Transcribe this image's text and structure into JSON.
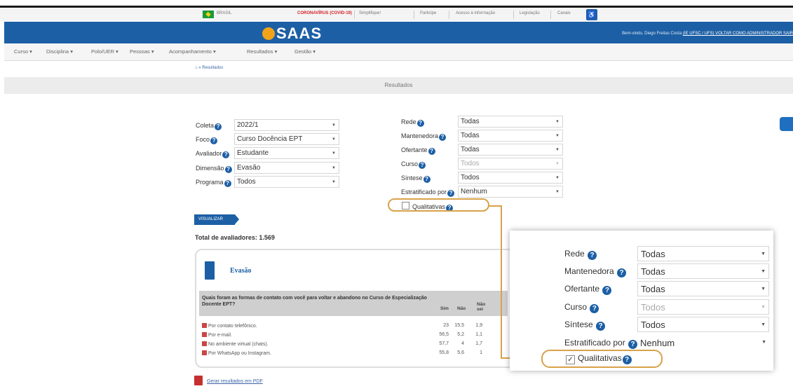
{
  "govbar": {
    "brasil": "BRASIL",
    "items": [
      "CORONAVÍRUS (COVID-19)",
      "Simplifique!",
      "Participe",
      "Acesso à informação",
      "Legislação",
      "Canais"
    ]
  },
  "header": {
    "logo": "SAAS",
    "welcome": "Bem-vindo, Diego Freitas Costa",
    "welcome_links": "(IE UFSC / UFS)   VOLTAR COMO ADMINISTRADOR   SAIR"
  },
  "nav": [
    "Curso",
    "Disciplina",
    "Polo/UER",
    "Pessoas",
    "Acompanhamento",
    "Resultados",
    "Gestão"
  ],
  "breadcrumb": "⌂ » Resultados",
  "page_title": "Resultados",
  "form_left": [
    {
      "label": "Coleta",
      "value": "2022/1"
    },
    {
      "label": "Foco",
      "value": "Curso Docência EPT"
    },
    {
      "label": "Avaliador",
      "value": "Estudante"
    },
    {
      "label": "Dimensão",
      "value": "Evasão"
    },
    {
      "label": "Programa",
      "value": "Todos"
    }
  ],
  "form_right": [
    {
      "label": "Rede",
      "value": "Todas"
    },
    {
      "label": "Mantenedora",
      "value": "Todas"
    },
    {
      "label": "Ofertante",
      "value": "Todas"
    },
    {
      "label": "Curso",
      "value": "Todos",
      "disabled": true
    },
    {
      "label": "Síntese",
      "value": "Todos"
    },
    {
      "label": "Estratificado por",
      "value": "Nenhum"
    }
  ],
  "qualitativas_label": "Qualitativas",
  "visualizar": "VISUALIZAR",
  "total": "Total de avaliadores: 1.569",
  "result": {
    "title": "Evasão",
    "question": "Quais foram as formas de contato com você para voltar e abandono no Curso de Especialização Docente EPT?",
    "columns": [
      "Sim",
      "Não",
      "Não sei"
    ],
    "rows": [
      {
        "label": "Por contato telefônico.",
        "values": [
          "23",
          "15,5",
          "1,9"
        ]
      },
      {
        "label": "Por e-mail.",
        "values": [
          "56,5",
          "5,2",
          "1,1"
        ]
      },
      {
        "label": "No ambiente virtual (chats).",
        "values": [
          "57,7",
          "4",
          "1,7"
        ]
      },
      {
        "label": "Por WhatsApp ou Instagram.",
        "values": [
          "55,8",
          "5,6",
          "1"
        ]
      }
    ]
  },
  "pdf_link": "Gerar resultados em PDF",
  "zoom": {
    "rows": [
      {
        "label": "Rede",
        "value": "Todas"
      },
      {
        "label": "Mantenedora",
        "value": "Todas"
      },
      {
        "label": "Ofertante",
        "value": "Todas"
      },
      {
        "label": "Curso",
        "value": "Todos",
        "disabled": true
      },
      {
        "label": "Síntese",
        "value": "Todos"
      },
      {
        "label": "Estratificado por",
        "value": "Nenhum"
      }
    ],
    "qualitativas_label": "Qualitativas",
    "qualitativas_checked": true
  },
  "colors": {
    "brand_blue": "#1c5fa5",
    "highlight": "#d8a24a"
  }
}
